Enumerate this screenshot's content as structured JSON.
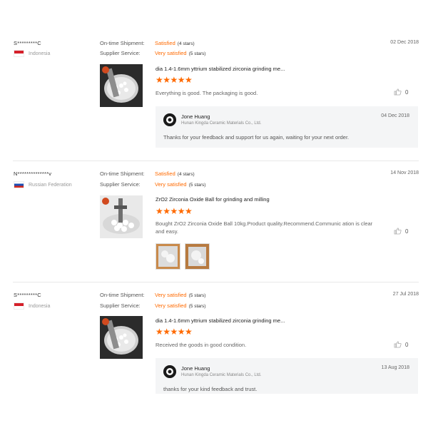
{
  "reviews": [
    {
      "buyer": "S*********C",
      "country": "Indonesia",
      "flag": "indonesia-flag",
      "shipment_label": "On-time Shipment:",
      "shipment_value": "Satisfied",
      "shipment_stars": "(4 stars)",
      "service_label": "Supplier Service:",
      "service_value": "Very satisfied",
      "service_stars": "(5 stars)",
      "date": "02 Dec 2018",
      "product_title": "dia 1.4-1.6mm yttrium stabilized zirconia grinding me...",
      "stars": "★★★★★",
      "rating": 5,
      "comment": "Everything is good. The packaging is good.",
      "likes": "0",
      "reply": {
        "name": "Jone Huang",
        "company": "Hunan Kingda Ceramic Materials Co., Ltd.",
        "date": "04 Dec 2018",
        "text": "Thanks for your feedback and support for us again, waiting for your next order."
      }
    },
    {
      "buyer": "N**************v",
      "country": "Russian Federation",
      "flag": "russia-flag",
      "shipment_label": "On-time Shipment:",
      "shipment_value": "Satisfied",
      "shipment_stars": "(4 stars)",
      "service_label": "Supplier Service:",
      "service_value": "Very satisfied",
      "service_stars": "(5 stars)",
      "date": "14 Nov 2018",
      "product_title": "ZrO2 Zirconia Oxide Ball for grinding and milling",
      "stars": "★★★★★",
      "rating": 5,
      "comment": "Bought ZrO2 Zirconia Oxide Ball 10kg.Product quality.Recommend.Communic ation is clear and easy.",
      "likes": "0"
    },
    {
      "buyer": "S*********C",
      "country": "Indonesia",
      "flag": "indonesia-flag",
      "shipment_label": "On-time Shipment:",
      "shipment_value": "Very satisfied",
      "shipment_stars": "(5 stars)",
      "service_label": "Supplier Service:",
      "service_value": "Very satisfied",
      "service_stars": "(5 stars)",
      "date": "27 Jul 2018",
      "product_title": "dia 1.4-1.6mm yttrium stabilized zirconia grinding me...",
      "stars": "★★★★★",
      "rating": 5,
      "comment": "Received the goods in good condition.",
      "likes": "0",
      "reply": {
        "name": "Jone Huang",
        "company": "Hunan Kingda Ceramic Materials Co., Ltd.",
        "date": "13 Aug 2018",
        "text": "thanks for your kind feedback and trust."
      }
    }
  ],
  "colors": {
    "accent": "#ff6a00",
    "reply_bg": "#f4f5f6",
    "divider": "#e8e8e8"
  }
}
